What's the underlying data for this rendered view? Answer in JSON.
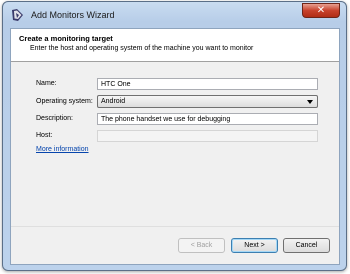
{
  "window": {
    "title": "Add Monitors Wizard",
    "close_label": "✕"
  },
  "header": {
    "title": "Create a monitoring target",
    "subtitle": "Enter the host and operating system of the machine you want to monitor"
  },
  "form": {
    "name_label": "Name:",
    "name_value": "HTC One",
    "os_label": "Operating system:",
    "os_value": "Android",
    "description_label": "Description:",
    "description_value": "The phone handset we use for debugging",
    "host_label": "Host:",
    "host_value": ""
  },
  "more_info_link": "More information",
  "buttons": {
    "back": "< Back",
    "next": "Next >",
    "cancel": "Cancel"
  },
  "icons": {
    "app": "wizard-app-icon",
    "close": "close-icon",
    "dropdown": "chevron-down-icon"
  },
  "colors": {
    "link": "#0645ad",
    "close_button": "#c8422c",
    "titlebar": "#c9dcf1"
  }
}
